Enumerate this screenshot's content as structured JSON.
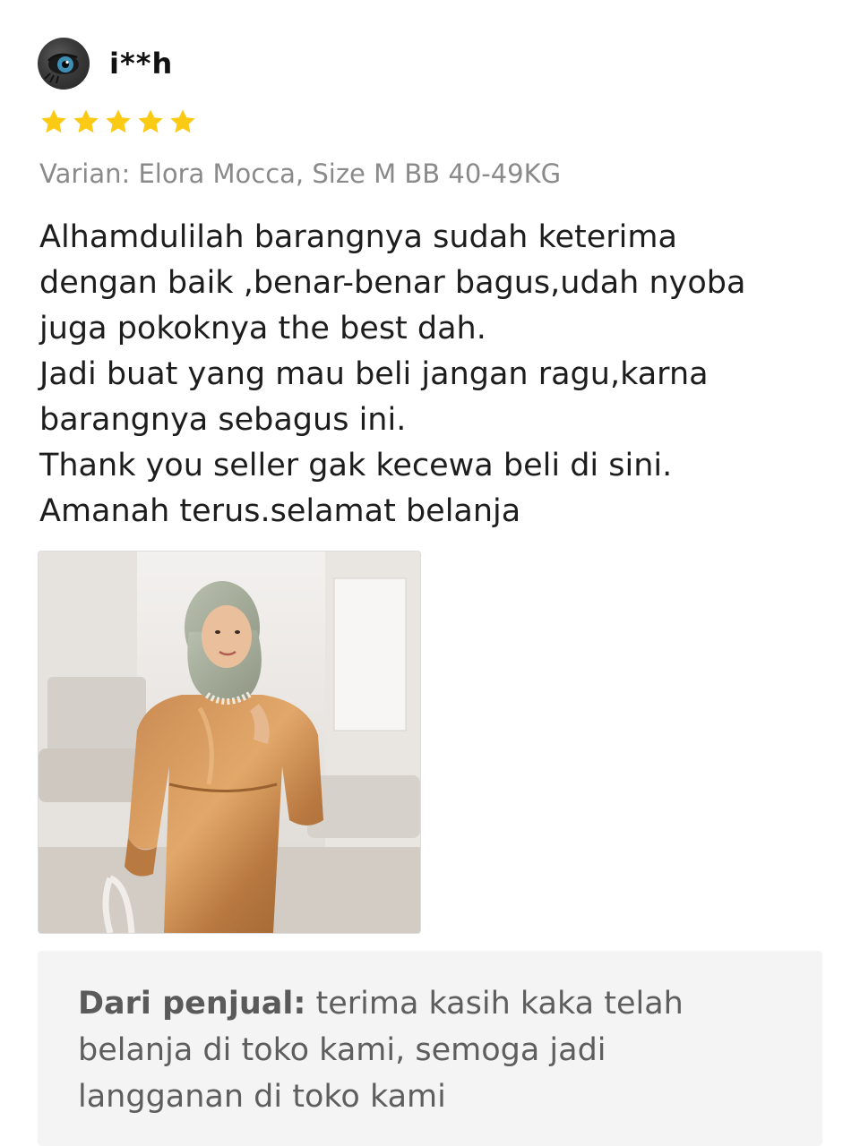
{
  "reviewer": {
    "name": "i**h",
    "avatar_icon": "eye-avatar-icon"
  },
  "rating": {
    "value": 5,
    "max": 5,
    "color": "#FACA15"
  },
  "variant": "Varian: Elora Mocca, Size M BB 40-49KG",
  "comment_lines": [
    "Alhamdulilah barangnya sudah keterima",
    "dengan baik ,benar-benar bagus,udah nyoba",
    "juga pokoknya the best dah.",
    "Jadi buat yang mau beli jangan ragu,karna",
    "barangnya sebagus ini.",
    "Thank you seller gak kecewa beli di sini.",
    "Amanah terus.selamat belanja"
  ],
  "photo": {
    "subject": "woman in hijab wearing mocca satin dress"
  },
  "seller_reply": {
    "label": "Dari penjual:",
    "first_line": " terima kasih kaka telah",
    "lines": [
      "belanja di toko kami, semoga jadi",
      "langganan di toko kami"
    ]
  }
}
